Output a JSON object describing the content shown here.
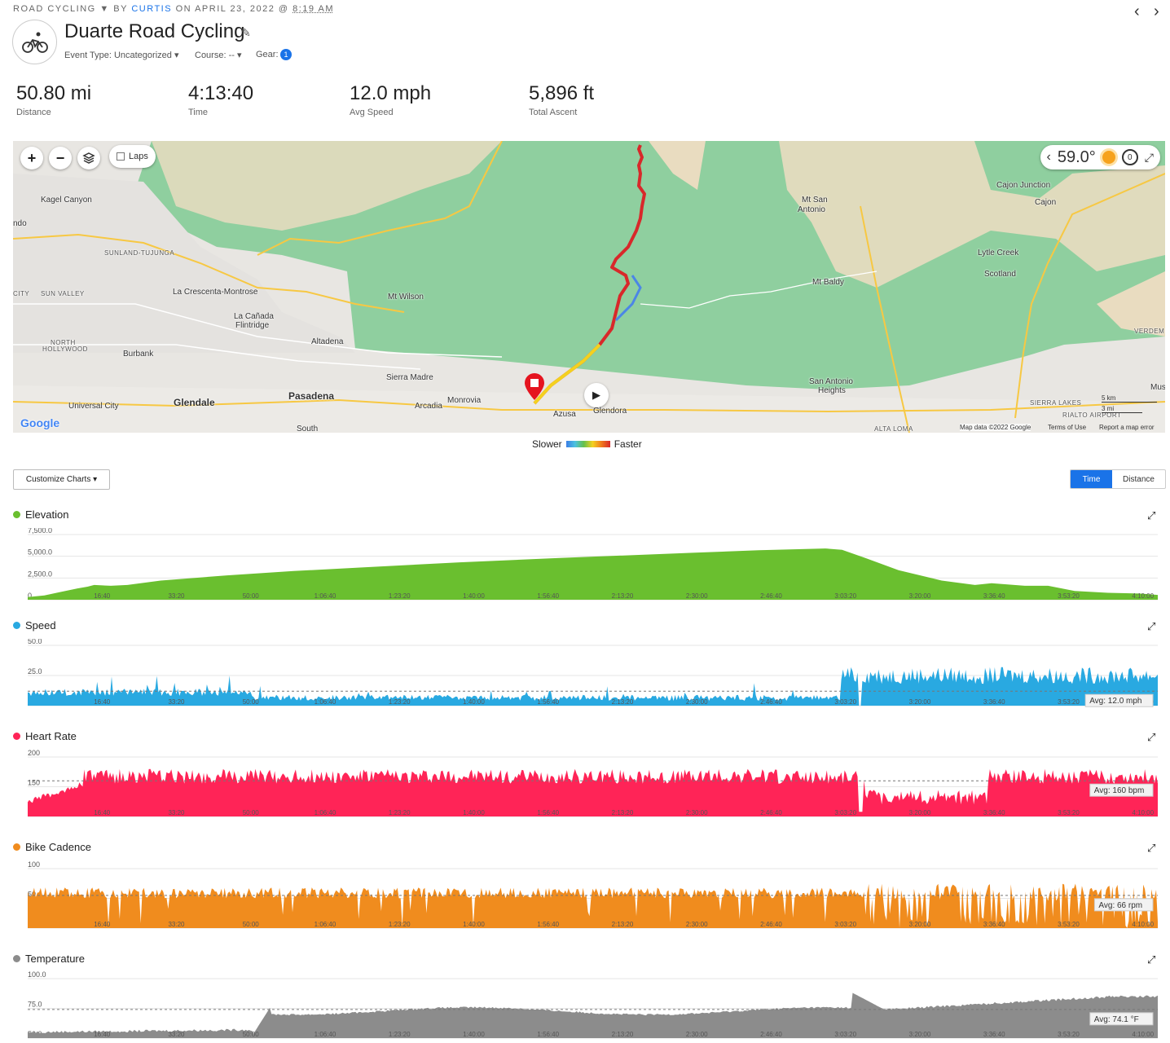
{
  "header": {
    "activity_type": "ROAD CYCLING",
    "by": "BY",
    "user": "CURTIS",
    "on": "ON APRIL 23, 2022 @",
    "time": "8:19 AM",
    "title": "Duarte Road Cycling",
    "event_type": "Event Type: Uncategorized",
    "course": "Course: --",
    "gear": "Gear:",
    "gear_count": "1",
    "prev": "‹",
    "next": "›"
  },
  "stats": [
    {
      "value": "50.80 mi",
      "label": "Distance"
    },
    {
      "value": "4:13:40",
      "label": "Time"
    },
    {
      "value": "12.0 mph",
      "label": "Avg Speed"
    },
    {
      "value": "5,896 ft",
      "label": "Total Ascent"
    }
  ],
  "map": {
    "laps": "Laps",
    "temperature": "59.0°",
    "timer": "0",
    "attribution": "Map data ©2022 Google",
    "terms": "Terms of Use",
    "report": "Report a map error",
    "google": "Google",
    "scale_km": "5 km",
    "scale_mi": "3 mi",
    "labels": {
      "kagel": "Kagel Canyon",
      "sunland": "SUNLAND-TUJUNGA",
      "crescenta": "La Crescenta-Montrose",
      "canada": "La Cañada",
      "flintridge": "Flintridge",
      "altadena": "Altadena",
      "burbank": "Burbank",
      "nhollywood": "NORTH",
      "nhollywood2": "HOLLYWOOD",
      "sunvalley": "SUN VALLEY",
      "glendale": "Glendale",
      "pasadena": "Pasadena",
      "universal": "Universal City",
      "sierramadre": "Sierra Madre",
      "arcadia": "Arcadia",
      "monrovia": "Monrovia",
      "azusa": "Azusa",
      "glendora": "Glendora",
      "mtwilson": "Mt Wilson",
      "mtsanantonio": "Mt San",
      "mtsanantonio2": "Antonio",
      "mtbaldy": "Mt Baldy",
      "cajonjct": "Cajon Junction",
      "cajon": "Cajon",
      "lytle": "Lytle Creek",
      "scotland": "Scotland",
      "sanantonioheights": "San Antonio",
      "sanantonioheights2": "Heights",
      "sierralakes": "SIERRA LAKES",
      "rialto": "RIALTO AIRPORT",
      "altaloma": "ALTA LOMA",
      "verdemont": "VERDEM",
      "mus": "Mus",
      "ando": "ndo",
      "city": "CITY",
      "south": "South"
    }
  },
  "legend": {
    "slower": "Slower",
    "faster": "Faster"
  },
  "controls": {
    "customize": "Customize Charts ▾",
    "time": "Time",
    "distance": "Distance"
  },
  "x_ticks": [
    "16:40",
    "33:20",
    "50:00",
    "1:06:40",
    "1:23:20",
    "1:40:00",
    "1:56:40",
    "2:13:20",
    "2:30:00",
    "2:46:40",
    "3:03:20",
    "3:20:00",
    "3:36:40",
    "3:53:20",
    "4:10:00"
  ],
  "charts": [
    {
      "name": "Elevation",
      "color": "#6abf2f",
      "y_ticks": [
        "7,500.0",
        "5,000.0",
        "2,500.0",
        "0"
      ],
      "ylim": [
        0,
        7500
      ],
      "avg_label": "",
      "type": "area",
      "series": [
        [
          0,
          300
        ],
        [
          5,
          500
        ],
        [
          10,
          900
        ],
        [
          15,
          1300
        ],
        [
          18,
          1500
        ],
        [
          20,
          1700
        ],
        [
          25,
          1600
        ],
        [
          30,
          1700
        ],
        [
          40,
          2200
        ],
        [
          60,
          2800
        ],
        [
          80,
          3300
        ],
        [
          100,
          3700
        ],
        [
          130,
          4300
        ],
        [
          160,
          4800
        ],
        [
          180,
          5100
        ],
        [
          200,
          5400
        ],
        [
          220,
          5700
        ],
        [
          240,
          5900
        ],
        [
          245,
          5750
        ],
        [
          252,
          4800
        ],
        [
          262,
          3400
        ],
        [
          275,
          2200
        ],
        [
          285,
          1700
        ],
        [
          290,
          1900
        ],
        [
          300,
          1600
        ],
        [
          307,
          1600
        ],
        [
          315,
          1000
        ],
        [
          325,
          800
        ],
        [
          335,
          700
        ],
        [
          340,
          550
        ]
      ]
    },
    {
      "name": "Speed",
      "color": "#29a9e1",
      "y_ticks": [
        "50.0",
        "25.0",
        "0.0"
      ],
      "ylim": [
        0,
        50
      ],
      "avg": 12.0,
      "avg_label": "Avg: 12.0 mph",
      "type": "area"
    },
    {
      "name": "Heart Rate",
      "color": "#ff2457",
      "y_ticks": [
        "200",
        "150",
        "100"
      ],
      "ylim": [
        100,
        200
      ],
      "avg": 160,
      "avg_label": "Avg: 160 bpm",
      "type": "area"
    },
    {
      "name": "Bike Cadence",
      "color": "#f08c1e",
      "y_ticks": [
        "100",
        "50",
        "0"
      ],
      "ylim": [
        0,
        120
      ],
      "avg": 66,
      "avg_label": "Avg: 66 rpm",
      "type": "area"
    },
    {
      "name": "Temperature",
      "color": "#8c8c8c",
      "y_ticks": [
        "100.0",
        "75.0",
        "50.0"
      ],
      "ylim": [
        50,
        100
      ],
      "avg": 74.1,
      "avg_label": "Avg: 74.1 °F",
      "type": "area"
    }
  ],
  "colors": {
    "accent": "#1a73e8",
    "elevation": "#6abf2f",
    "speed": "#29a9e1",
    "heart": "#ff2457",
    "cadence": "#f08c1e",
    "temperature": "#8c8c8c"
  }
}
